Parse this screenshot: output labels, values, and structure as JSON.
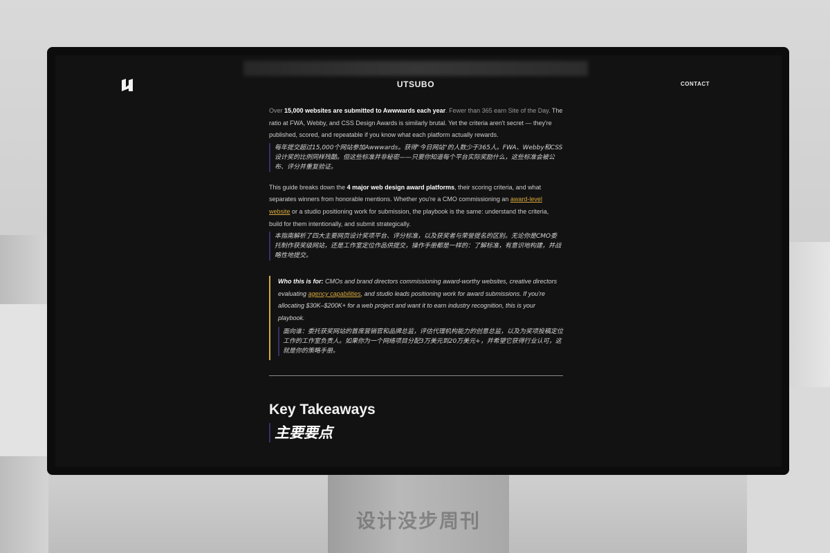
{
  "header": {
    "brand": "UTSUBO",
    "contact_label": "CONTACT"
  },
  "intro": {
    "pre": "Over ",
    "bold": "15,000 websites are submitted to Awwwards each year",
    "post_muted": ". Fewer than 365 earn Site of the Day.",
    "rest": " The ratio at FWA, Webby, and CSS Design Awards is similarly brutal. Yet the criteria aren't secret — they're published, scored, and repeatable if you know what each platform actually rewards.",
    "zh": "每年提交超过15,000个网站参加Awwwards。获得\"今日网站\"的人数少于365人。FWA、Webby和CSS设计奖的比例同样残酷。但这些标准并非秘密——只要你知道每个平台实际奖励什么，这些标准会被公布、评分并重复验证。"
  },
  "guide": {
    "pre": "This guide breaks down the ",
    "bold": "4 major web design award platforms",
    "mid": ", their scoring criteria, and what separates winners from honorable mentions. Whether you're a CMO commissioning an ",
    "link": "award-level website",
    "post": " or a studio positioning work for submission, the playbook is the same: understand the criteria, build for them intentionally, and submit strategically.",
    "zh": "本指南解析了四大主要网页设计奖项平台、评分标准，以及获奖者与荣誉提名的区别。无论你是CMO委托制作获奖级网站，还是工作室定位作品供提交，操作手册都是一样的：了解标准，有意识地构建，并战略性地提交。"
  },
  "callout": {
    "lead": "Who this is for:",
    "pre": " CMOs and brand directors commissioning award-worthy websites, creative directors evaluating ",
    "link": "agency capabilities",
    "post": ", and studio leads positioning work for award submissions. If you're allocating $30K–$200K+ for a web project and want it to earn industry recognition, this is your playbook.",
    "zh": "面向谁：委托获奖网站的首席营销官和品牌总监，评估代理机构能力的创意总监，以及为奖项投稿定位工作的工作室负责人。如果你为一个网络项目分配3万美元到20万美元+，并希望它获得行业认可，这就是你的策略手册。"
  },
  "section": {
    "title": "Key Takeaways",
    "title_zh": "主要要点"
  },
  "watermark": "设计没步周刊",
  "colors": {
    "screen_bg": "#121212",
    "accent_gold": "#d8a93e",
    "zh_rule": "#3a2f66"
  }
}
